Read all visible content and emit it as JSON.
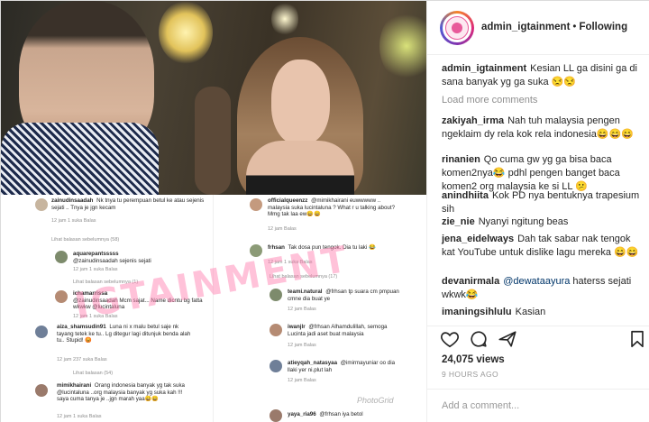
{
  "header": {
    "username": "admin_igtainment",
    "separator": "•",
    "follow_status": "Following"
  },
  "caption": {
    "user": "admin_igtainment",
    "text": "Kesian LL ga disini ga di sana banyak yg ga suka 😒😒"
  },
  "load_more": "Load more comments",
  "comments": [
    {
      "user": "zakiyah_irma",
      "text": "Nah tuh malaysia pengen ngeklaim dy rela kok rela indonesia😄😄😄"
    },
    {
      "user": "rinanien",
      "text": "Qo cuma gw yg ga bisa baca komen2nya😂 pdhl pengen banget baca komen2 org malaysia ke si LL 😕"
    },
    {
      "user": "anindhiita",
      "text": "Kok PD nya bentuknya trapesium sih"
    },
    {
      "user": "zie_nie",
      "text": "Nyanyi ngitung beas"
    },
    {
      "user": "jena_eidelways",
      "text": "Dah tak sabar nak tengok kat YouTube untuk dislike lagu mereka 😄😄"
    },
    {
      "user": "devanirmala",
      "mention": "@dewataayura",
      "text": " haterss sejati wkwk😂"
    },
    {
      "user": "imaningsihlulu",
      "text": "Kasian"
    }
  ],
  "likes": "24,075 views",
  "timestamp": "9 HOURS AGO",
  "add_comment_placeholder": "Add a comment...",
  "icons": {
    "like": "heart-icon",
    "comment": "comment-bubble-icon",
    "share": "share-icon",
    "save": "bookmark-icon"
  },
  "screenshot_comments": {
    "left": [
      {
        "user": "zainudinsaadah",
        "text": "Nk tnya tu perempuan betul ke atau sejenis sejati .. Tnya je jgn kecam",
        "meta": "12 jam   1 suka   Balas"
      },
      {
        "thread": "Lihat balasan sebelumnya (58)"
      },
      {
        "user": "aquarepantsssss",
        "text": "@zainudinsaadah sejenis sejati",
        "meta": "12 jam   1 suka   Balas"
      },
      {
        "thread": "Lihat balasan sebelumnya (1)"
      },
      {
        "user": "ichamarrissa",
        "text": "@zainudinsaadah Mcm sajat... Name dicntu bg fatta wkwkw @lucintaluna",
        "meta": "12 jam   1 suka   Balas"
      },
      {
        "user": "aiza_shamsudin91",
        "text": "Luna ni x malu betul saje nk tayang tetek ke tu.. Lg ditegur lagi ditunjuk benda alah tu.. Stupid! 😡",
        "meta": "12 jam   237 suka   Balas"
      },
      {
        "thread": "Lihat balasan (54)"
      },
      {
        "user": "mimikhairani",
        "text": "Orang indonesia banyak yg tak suka @lucintaluna ..org malaysia banyak yg suka kah !!! saya cuma tanya je ..jgn marah yaa😄😄",
        "meta": "12 jam   1 suka   Balas"
      }
    ],
    "right": [
      {
        "user": "officialqueenzz",
        "text": "@mimikhairani euwwwww .. malaysia suka lucintaluna ? What r u talking about? Mmg tak laa ew😄😄",
        "meta": "12 jam   Balas"
      },
      {
        "user": "frhsan",
        "text": "Tak dosa pun tengok. Dia tu laki 😂",
        "meta": "12 jam   1 suka   Balas"
      },
      {
        "thread": "Lihat balasan sebelumnya (17)"
      },
      {
        "user": "teami.natural",
        "text": "@frhsan tp suara cm pmpuan cmne dia buat ye",
        "meta": "12 jam   Balas"
      },
      {
        "user": "iwanjlr",
        "text": "@frhsan Alhamdulillah, semoga Lucinta jadi aset buat malaysia",
        "meta": "12 jam   Balas"
      },
      {
        "user": "atieyqah_natasyaa",
        "text": "@imirmayuniar oo dia llaki yer ni.plut lah",
        "meta": "12 jam   Balas"
      },
      {
        "user": "yaya_ria96",
        "text": "@frhsan iya betol",
        "meta": ""
      }
    ],
    "watermark": "IGTAINMENT",
    "watermark_small": "PhotoGrid"
  }
}
